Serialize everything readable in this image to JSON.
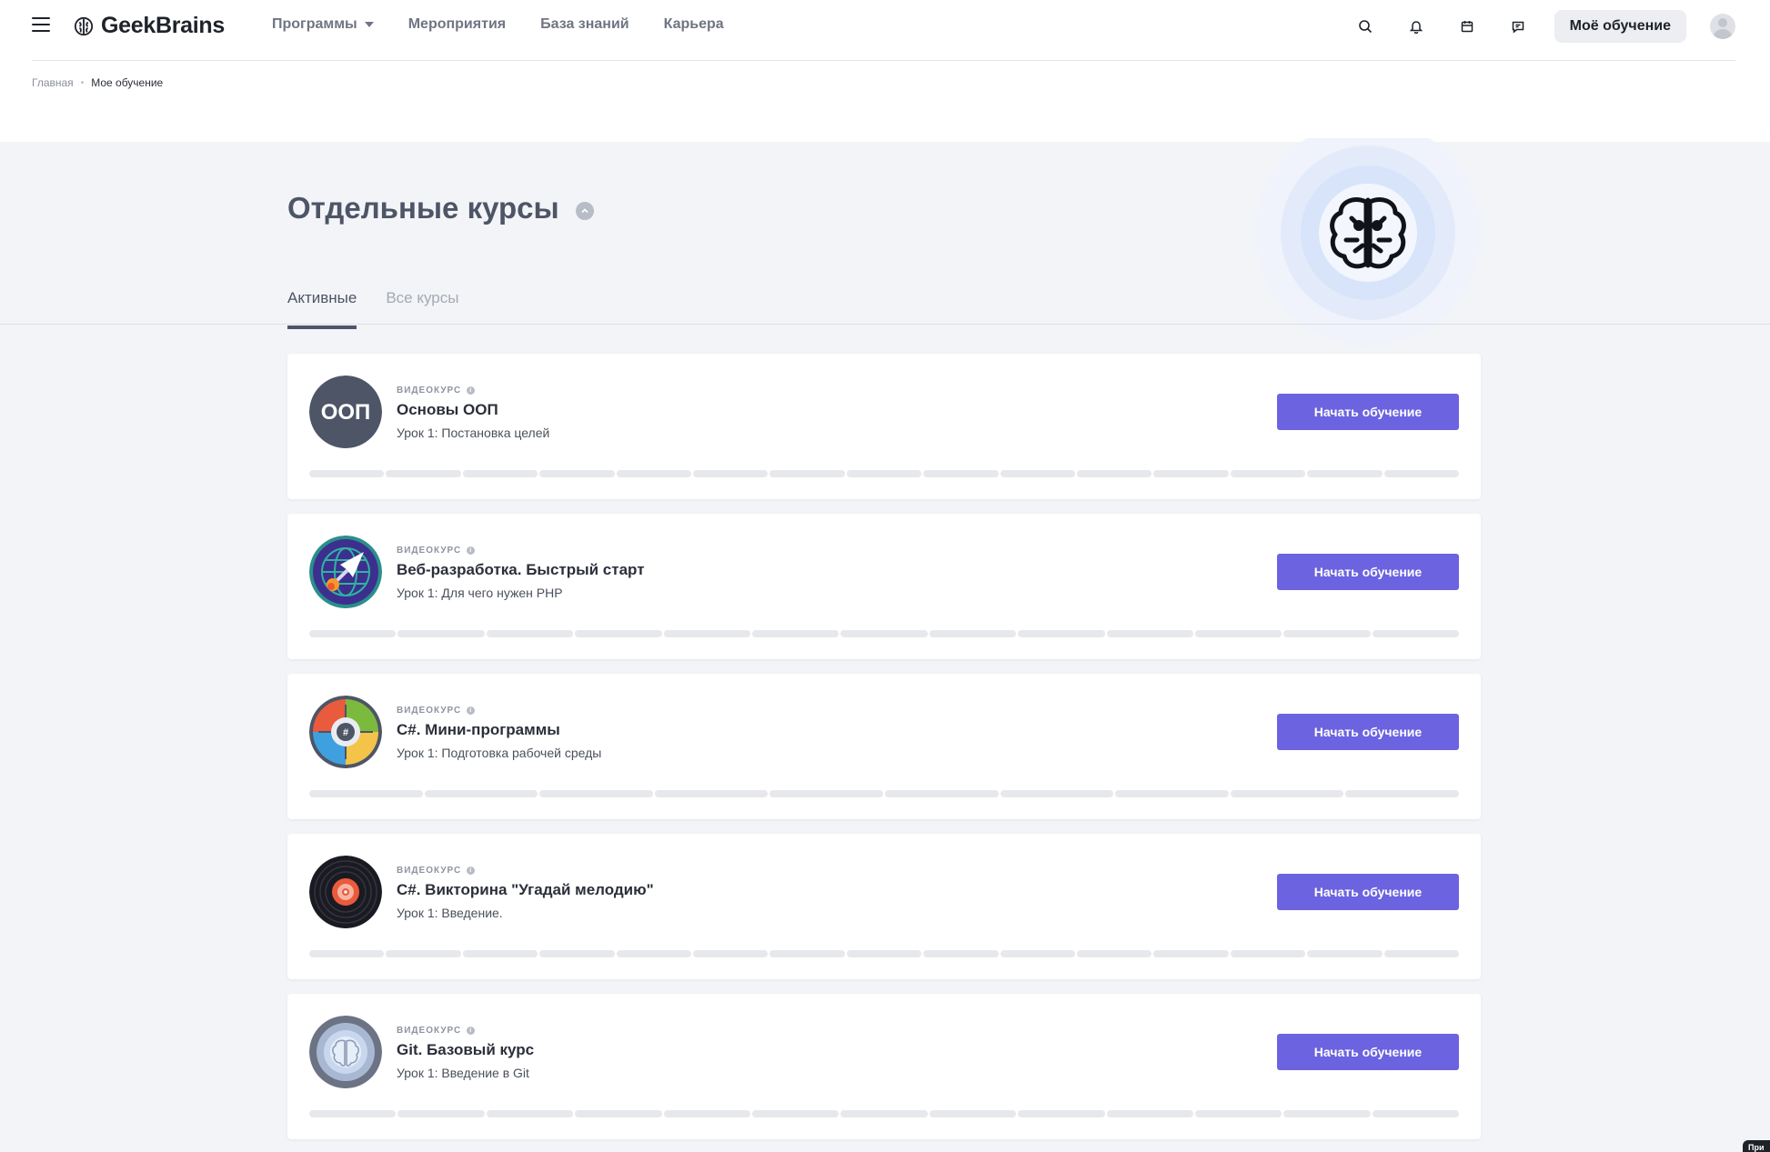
{
  "header": {
    "logo_text": "GeekBrains",
    "menu": [
      {
        "label": "Программы",
        "has_dropdown": true
      },
      {
        "label": "Мероприятия"
      },
      {
        "label": "База знаний"
      },
      {
        "label": "Карьера"
      }
    ],
    "icons": [
      "search-icon",
      "bell-icon",
      "calendar-icon",
      "chat-icon"
    ],
    "my_learning_label": "Моё обучение"
  },
  "breadcrumbs": {
    "home": "Главная",
    "current": "Мое обучение"
  },
  "hero": {
    "title": "Отдельные курсы",
    "tabs": [
      {
        "label": "Активные",
        "active": true
      },
      {
        "label": "Все курсы",
        "active": false
      }
    ]
  },
  "courses": [
    {
      "type": "видеокурс",
      "title": "Основы ООП",
      "lesson": "Урок 1: Постановка целей",
      "button": "Начать обучение",
      "icon": "oop-badge",
      "icon_text": "ООП",
      "progress_segments": 15,
      "progress_completed": 0
    },
    {
      "type": "видеокурс",
      "title": "Веб-разработка. Быстрый старт",
      "lesson": "Урок 1: Для чего нужен PHP",
      "button": "Начать обучение",
      "icon": "web-rocket-icon",
      "progress_segments": 13,
      "progress_completed": 0
    },
    {
      "type": "видеокурс",
      "title": "C#. Мини-программы",
      "lesson": "Урок 1: Подготовка рабочей среды",
      "button": "Начать обучение",
      "icon": "csharp-mini-icon",
      "progress_segments": 10,
      "progress_completed": 0
    },
    {
      "type": "видеокурс",
      "title": "C#. Викторина \"Угадай мелодию\"",
      "lesson": "Урок 1: Введение.",
      "button": "Начать обучение",
      "icon": "vinyl-icon",
      "progress_segments": 15,
      "progress_completed": 0
    },
    {
      "type": "видеокурс",
      "title": "Git. Базовый курс",
      "lesson": "Урок 1: Введение в Git",
      "button": "Начать обучение",
      "icon": "git-brain-icon",
      "progress_segments": 13,
      "progress_completed": 0
    }
  ],
  "corner_chip": "При",
  "colors": {
    "accent_button": "#6c63e0",
    "title_gray": "#4d5566",
    "page_bg": "#f3f4f8"
  }
}
